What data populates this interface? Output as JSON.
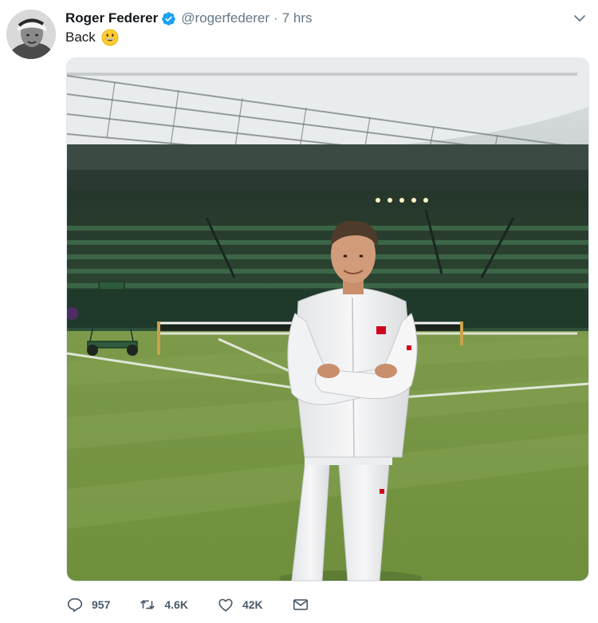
{
  "tweet": {
    "author_name": "Roger Federer",
    "handle": "@rogerfederer",
    "separator": "·",
    "time": "7 hrs",
    "text": "Back",
    "emoji": "grinning-face-emoji",
    "verified": true
  },
  "actions": {
    "reply_count": "957",
    "retweet_count": "4.6K",
    "like_count": "42K"
  },
  "icons": {
    "reply": "reply-icon",
    "retweet": "retweet-icon",
    "like": "heart-icon",
    "dm": "envelope-icon",
    "caret": "chevron-down-icon",
    "verified": "verified-badge-icon"
  },
  "colors": {
    "verified_blue": "#1da1f2",
    "meta_gray": "#657786",
    "action_gray": "#4a5a68"
  }
}
